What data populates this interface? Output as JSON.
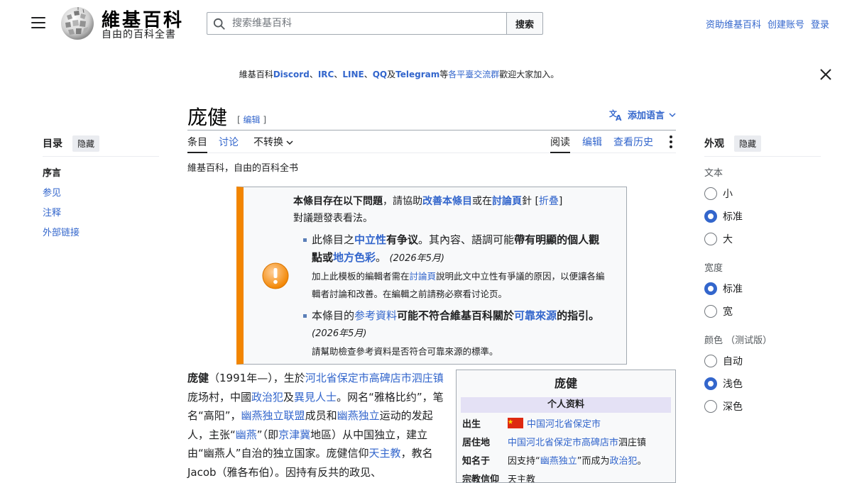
{
  "header": {
    "site_title": "維基百科",
    "tagline": "自由的百科全書",
    "search_placeholder": "搜索维基百科",
    "search_button": "搜索",
    "user_links": [
      "资助维基百科",
      "创建账号",
      "登录"
    ]
  },
  "banner": {
    "prefix": "維基百科",
    "discord": "Discord",
    "sep1": "、",
    "irc": "IRC",
    "sep2": "、",
    "line": "LINE",
    "sep3": "、",
    "qq": "QQ",
    "and": "及",
    "telegram": "Telegram",
    "mid": "等",
    "groups_link": "各平臺交流群",
    "suffix": "歡迎大家加入。"
  },
  "toc": {
    "title": "目录",
    "hide_label": "隐藏",
    "items": [
      "序言",
      "参见",
      "注释",
      "外部链接"
    ]
  },
  "article": {
    "title": "庞健",
    "edit_open": "[",
    "edit_label": "编辑",
    "edit_close": "]",
    "add_language": "添加语言",
    "tabs_left": [
      "条目",
      "讨论",
      "不转换"
    ],
    "tabs_right": [
      "阅读",
      "编辑",
      "查看历史"
    ],
    "tagline": "維基百科，自由的百科全书"
  },
  "ambox": {
    "head_bold": "本條目存在以下問題",
    "head_mid": "，請協助",
    "improve_link": "改善本條目",
    "head_or": "或在",
    "talk_link": "討論頁",
    "head_tail": "針",
    "fold_open": "[",
    "fold_link": "折叠",
    "fold_close": "]",
    "head_line2": "對議題發表看法。",
    "issue1": {
      "a": "此條目之",
      "neutral_link": "中立性",
      "b": "有争议",
      "c": "。其內容、語調可能",
      "d": "帶有明顯的個人觀點或",
      "local_link": "地方色彩",
      "e": "。",
      "date": "(2026年5月)",
      "note_a": "加上此模板的編輯者需在",
      "note_link": "討論頁",
      "note_b": "說明此文中立性有爭議的原因，以便讓各編輯者討論和改善。在編輯之前請務必察看讨论页。"
    },
    "issue2": {
      "a": "本條目的",
      "ref_link": "参考資料",
      "b": "可能不符合維基百科關於",
      "rel_link": "可靠來源",
      "c": "的指引。",
      "date": "(2026年5月)",
      "note": "請幫助檢查參考資料是否符合可靠來源的標準。"
    }
  },
  "body_text": {
    "name": "庞健",
    "t1": "（1991年—），生於",
    "l1": "河北省保定市高碑店市泗庄镇",
    "t2": "庞场村，中國",
    "l2": "政治犯",
    "t3": "及",
    "l3": "異見人士",
    "t4": "。网名“雅格比约”，笔名“高阳”，",
    "l4": "幽燕独立联盟",
    "t5": "成员和",
    "l5": "幽燕独立",
    "t6": "运动的发起人，主张“",
    "l6": "幽燕",
    "t7": "”（即",
    "l7": "京津冀",
    "t8": "地區）从中国独立，建立由“幽燕人”自治的独立国家。庞健信仰",
    "l8": "天主教",
    "t9": "，教名Jacob（雅各布伯）。因持有反共的政见、"
  },
  "infobox": {
    "title": "庞健",
    "section": "个人资料",
    "rows": [
      {
        "label": "出生",
        "value": "中国河北省保定市"
      },
      {
        "label": "居住地",
        "value_link": "中国河北省保定市高碑店市",
        "value_tail": "泗庄镇"
      },
      {
        "label": "知名于",
        "a": "因支持“",
        "link1": "幽燕独立",
        "b": "”而成为",
        "link2": "政治犯",
        "c": "。"
      },
      {
        "label": "宗教信仰",
        "value": "天主教"
      }
    ]
  },
  "appearance": {
    "title": "外观",
    "hide_label": "隐藏",
    "text_section": "文本",
    "text_options": [
      "小",
      "标准",
      "大"
    ],
    "text_selected": "标准",
    "width_section": "宽度",
    "width_options": [
      "标准",
      "宽"
    ],
    "width_selected": "标准",
    "color_section": "颜色 （测试版）",
    "color_options": [
      "自动",
      "浅色",
      "深色"
    ],
    "color_selected": "浅色"
  },
  "colors": {
    "link": "#3366cc",
    "ambox_border": "#f28500",
    "infobox_header": "#e4e1f5"
  }
}
